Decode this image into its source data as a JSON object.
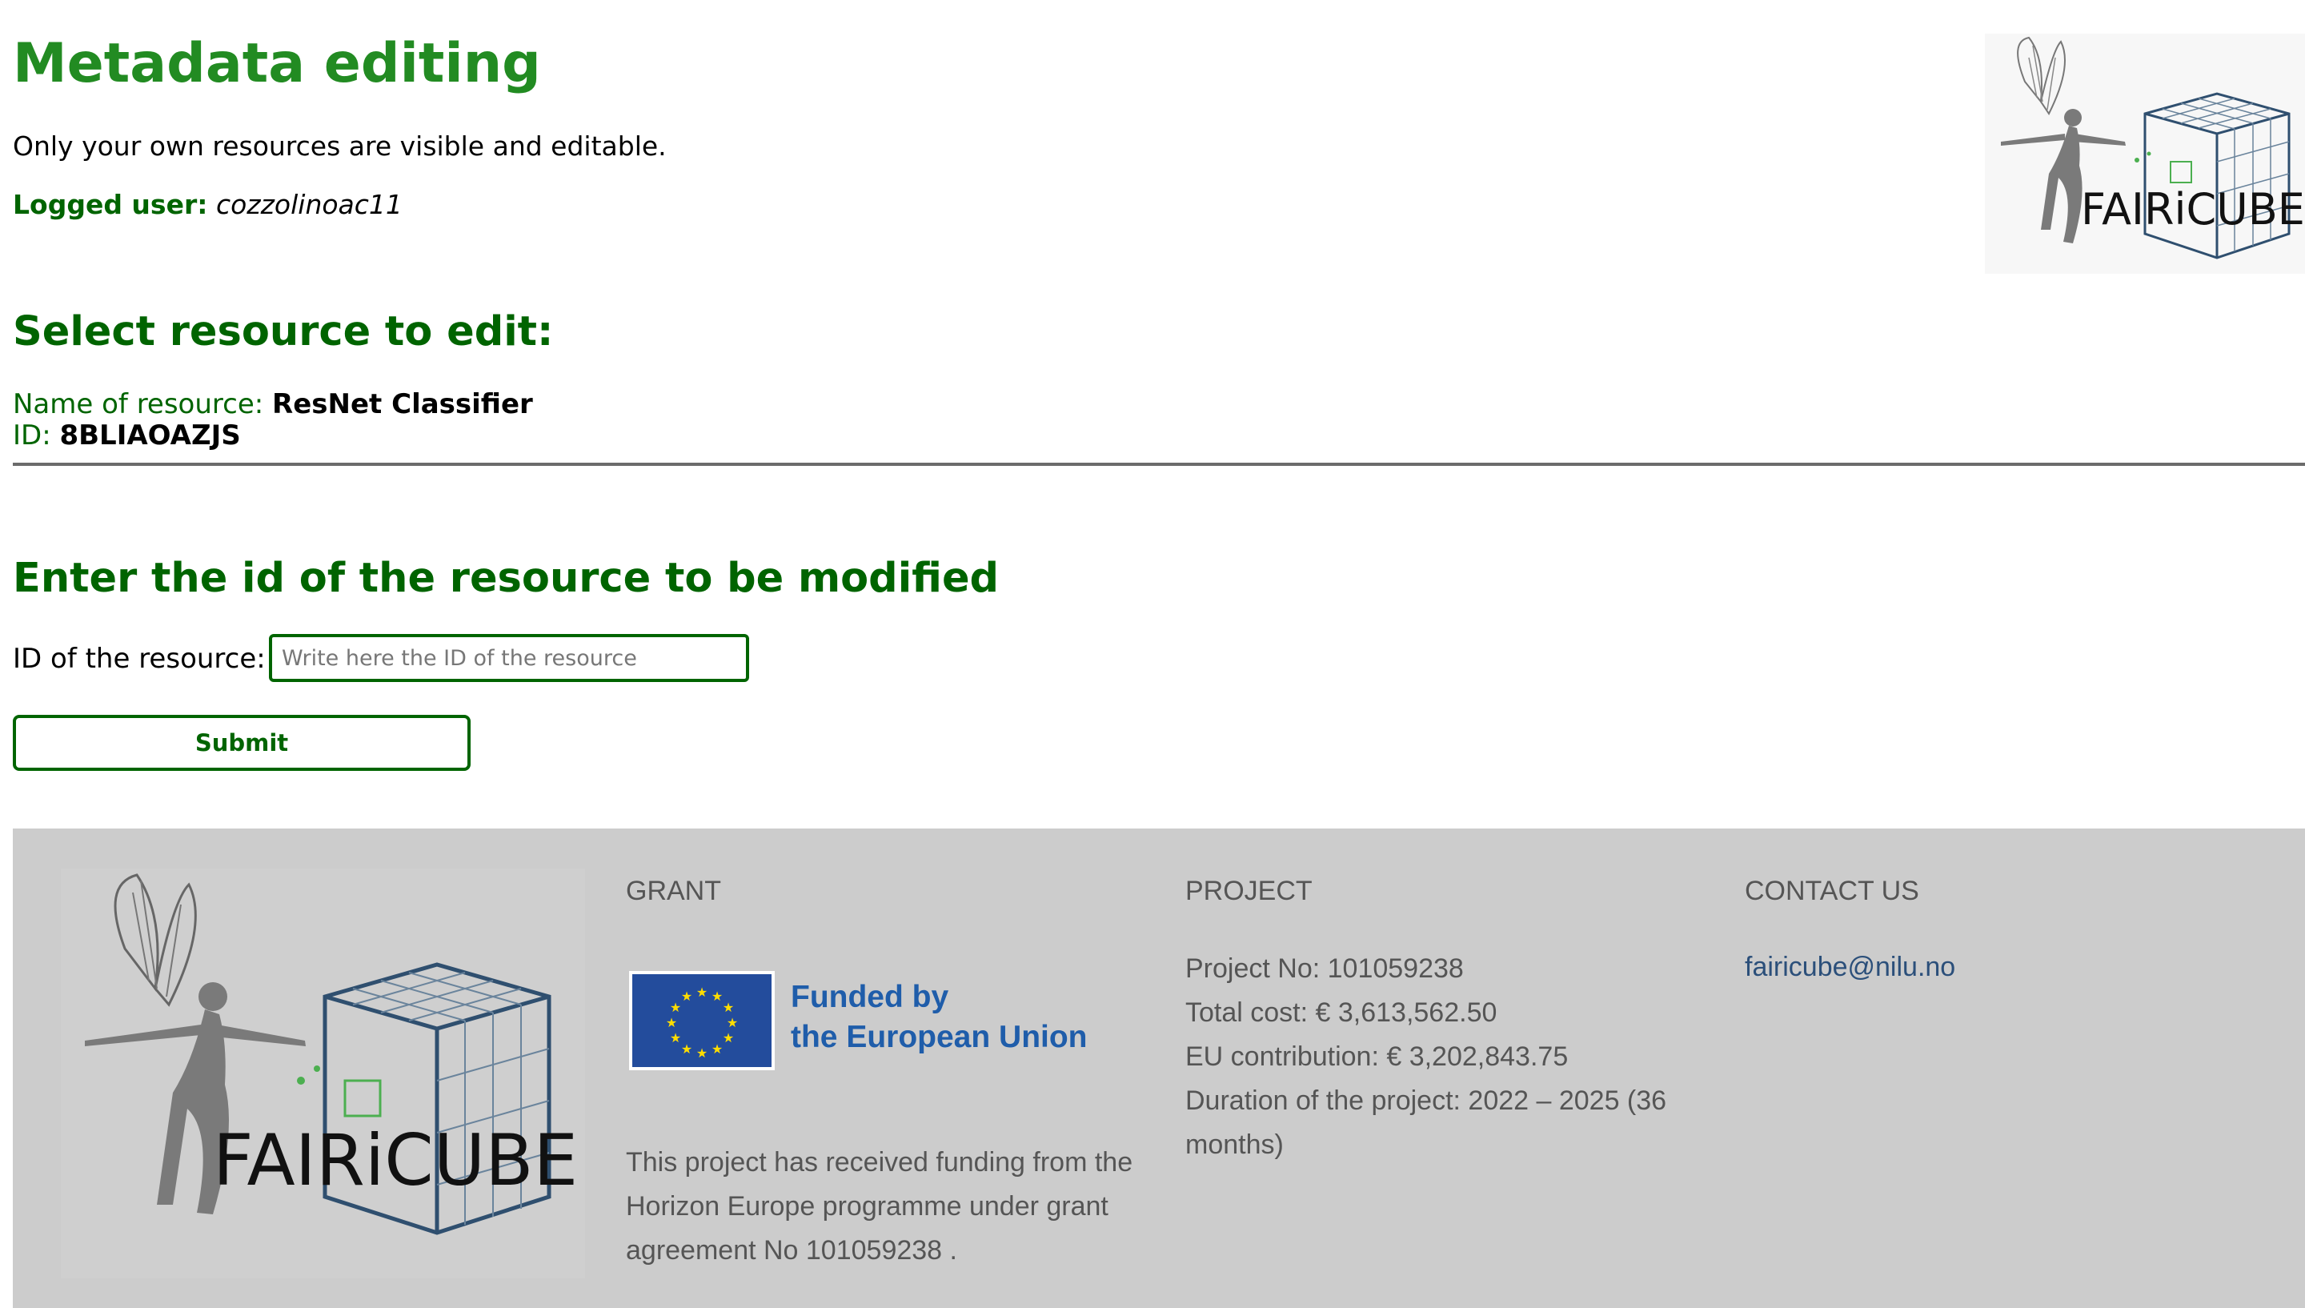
{
  "header": {
    "title": "Metadata editing",
    "subtitle": "Only your own resources are visible and editable.",
    "logged_label": "Logged user:",
    "logged_user": "cozzolinoac11",
    "logo_text": "FAIRiCUBE"
  },
  "select_section": {
    "heading": "Select resource to edit:",
    "name_label": "Name of resource:",
    "name_value": "ResNet Classifier",
    "id_label": "ID:",
    "id_value": "8BLIAOAZJS"
  },
  "enter_section": {
    "heading": "Enter the id of the resource to be modified",
    "input_label": "ID of the resource:",
    "input_placeholder": "Write here the ID of the resource",
    "input_value": "",
    "submit_label": "Submit"
  },
  "footer": {
    "logo_text": "FAIRiCUBE",
    "grant": {
      "heading": "GRANT",
      "eu_line1": "Funded by",
      "eu_line2": "the European Union",
      "text": "This project has received funding from the Horizon Europe programme under grant agreement No 101059238 ."
    },
    "project": {
      "heading": "PROJECT",
      "lines": [
        "Project No: 101059238",
        "Total cost: € 3,613,562.50",
        "EU contribution: € 3,202,843.75",
        "Duration of the project: 2022 – 2025 (36 months)"
      ]
    },
    "contact": {
      "heading": "CONTACT US",
      "email": "fairicube@nilu.no"
    }
  },
  "colors": {
    "title_green": "#228b22",
    "dark_green": "#006400",
    "footer_bg": "#cccccc",
    "footer_text": "#555555",
    "eu_blue": "#1f5daa",
    "link_blue": "#2b4f7a"
  }
}
